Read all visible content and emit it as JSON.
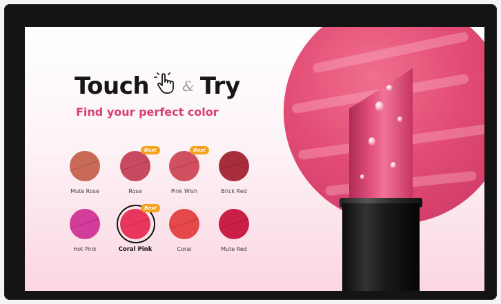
{
  "promo": {
    "title_part1": "Touch",
    "title_amp": "&",
    "title_part2": "Try",
    "subtitle": "Find your perfect color"
  },
  "colors": {
    "accent": "#d73f74",
    "badge": "#f7a21e",
    "selected_ring": "#111111"
  },
  "icons": {
    "pointer": "hand-pointer-icon"
  },
  "swatches": [
    {
      "name": "Mute Rose",
      "color": "#c96a59",
      "badge": ""
    },
    {
      "name": "Rose",
      "color": "#c84a61",
      "badge": "Best"
    },
    {
      "name": "Pink Wish",
      "color": "#d1505f",
      "badge": "Best"
    },
    {
      "name": "Brick Red",
      "color": "#a82d3b",
      "badge": ""
    },
    {
      "name": "Hot Pink",
      "color": "#d23c9a",
      "badge": ""
    },
    {
      "name": "Coral Pink",
      "color": "#e8365d",
      "badge": "Best",
      "selected": true
    },
    {
      "name": "Coral",
      "color": "#e44848",
      "badge": ""
    },
    {
      "name": "Mute Red",
      "color": "#c91e46",
      "badge": ""
    }
  ]
}
